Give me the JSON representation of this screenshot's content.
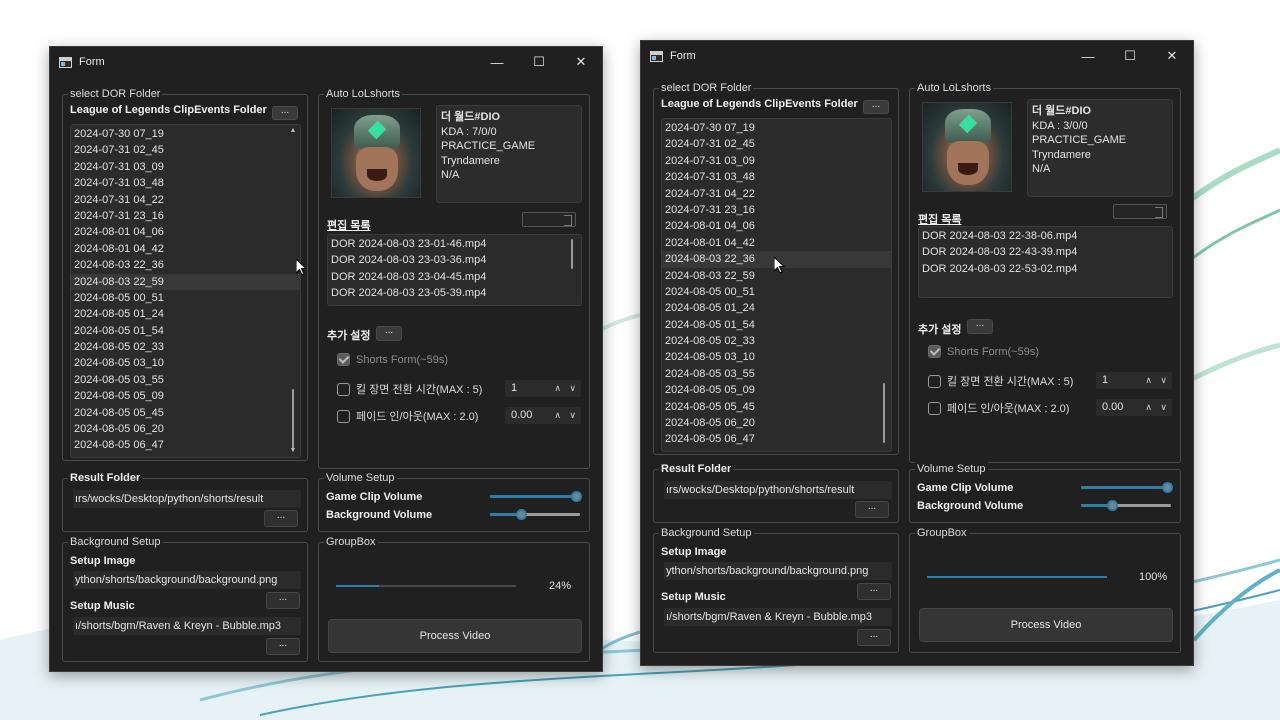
{
  "windows": [
    {
      "title": "Form",
      "dor_group": "select DOR Folder",
      "clip_folder_label": "League of Legends ClipEvents Folder",
      "browse": "...",
      "folders": [
        "2024-07-30 07_19",
        "2024-07-31 02_45",
        "2024-07-31 03_09",
        "2024-07-31 03_48",
        "2024-07-31 04_22",
        "2024-07-31 23_16",
        "2024-08-01 04_06",
        "2024-08-01 04_42",
        "2024-08-03 22_36",
        "2024-08-03 22_59",
        "2024-08-05 00_51",
        "2024-08-05 01_24",
        "2024-08-05 01_54",
        "2024-08-05 02_33",
        "2024-08-05 03_10",
        "2024-08-05 03_55",
        "2024-08-05 05_09",
        "2024-08-05 05_45",
        "2024-08-05 06_20",
        "2024-08-05 06_47"
      ],
      "selected_folder": "2024-08-03 22_59",
      "auto_group": "Auto LoLshorts",
      "player_info": [
        "더 월드#DIO",
        "KDA : 7/0/0",
        "PRACTICE_GAME",
        "Tryndamere",
        "N/A"
      ],
      "edit_list_label": "편집 목록",
      "edit_files": [
        "DOR 2024-08-03 23-01-46.mp4",
        "DOR 2024-08-03 23-03-36.mp4",
        "DOR 2024-08-03 23-04-45.mp4",
        "DOR 2024-08-03 23-05-39.mp4"
      ],
      "extra_settings_label": "추가 설정",
      "shorts_form_label": "Shorts Form(~59s)",
      "kill_transition_label": "킬 장면 전환 시간(MAX : 5)",
      "kill_transition_value": "1",
      "fade_label": "페이드 인/아웃(MAX : 2.0)",
      "fade_value": "0.00",
      "result_group": "Result Folder",
      "result_path": "ırs/wocks/Desktop/python/shorts/result",
      "volume_group": "Volume Setup",
      "game_clip_volume_label": "Game Clip Volume",
      "game_clip_volume": 0.97,
      "background_volume_label": "Background Volume",
      "background_volume": 0.35,
      "background_group": "Background Setup",
      "setup_image_label": "Setup Image",
      "setup_image_path": "ython/shorts/background/background.png",
      "setup_music_label": "Setup Music",
      "setup_music_path": "ı/shorts/bgm/Raven & Kreyn - Bubble.mp3",
      "groupbox_label": "GroupBox",
      "progress": 0.24,
      "progress_text": "24%",
      "process_button": "Process Video"
    },
    {
      "title": "Form",
      "dor_group": "select DOR Folder",
      "clip_folder_label": "League of Legends ClipEvents Folder",
      "browse": "...",
      "folders": [
        "2024-07-30 07_19",
        "2024-07-31 02_45",
        "2024-07-31 03_09",
        "2024-07-31 03_48",
        "2024-07-31 04_22",
        "2024-07-31 23_16",
        "2024-08-01 04_06",
        "2024-08-01 04_42",
        "2024-08-03 22_36",
        "2024-08-03 22_59",
        "2024-08-05 00_51",
        "2024-08-05 01_24",
        "2024-08-05 01_54",
        "2024-08-05 02_33",
        "2024-08-05 03_10",
        "2024-08-05 03_55",
        "2024-08-05 05_09",
        "2024-08-05 05_45",
        "2024-08-05 06_20",
        "2024-08-05 06_47"
      ],
      "selected_folder": "2024-08-03 22_36",
      "auto_group": "Auto LoLshorts",
      "player_info": [
        "더 월드#DIO",
        "KDA : 3/0/0",
        "PRACTICE_GAME",
        "Tryndamere",
        "N/A"
      ],
      "edit_list_label": "편집 목록",
      "edit_files": [
        "DOR 2024-08-03 22-38-06.mp4",
        "DOR 2024-08-03 22-43-39.mp4",
        "DOR 2024-08-03 22-53-02.mp4"
      ],
      "extra_settings_label": "추가 설정",
      "shorts_form_label": "Shorts Form(~59s)",
      "kill_transition_label": "킬 장면 전환 시간(MAX : 5)",
      "kill_transition_value": "1",
      "fade_label": "페이드 인/아웃(MAX : 2.0)",
      "fade_value": "0.00",
      "result_group": "Result Folder",
      "result_path": "ırs/wocks/Desktop/python/shorts/result",
      "volume_group": "Volume Setup",
      "game_clip_volume_label": "Game Clip Volume",
      "game_clip_volume": 0.97,
      "background_volume_label": "Background Volume",
      "background_volume": 0.35,
      "background_group": "Background Setup",
      "setup_image_label": "Setup Image",
      "setup_image_path": "ython/shorts/background/background.png",
      "setup_music_label": "Setup Music",
      "setup_music_path": "ı/shorts/bgm/Raven & Kreyn - Bubble.mp3",
      "groupbox_label": "GroupBox",
      "progress": 1.0,
      "progress_text": "100%",
      "process_button": "Process Video"
    }
  ],
  "colors": {
    "window_bg": "#202020",
    "panel_bg": "#2b2b2b",
    "accent": "#2e7fa8",
    "text": "#e6e6e6"
  },
  "icons": {
    "minimize": "minimize-icon",
    "maximize": "maximize-icon",
    "close": "close-icon"
  }
}
